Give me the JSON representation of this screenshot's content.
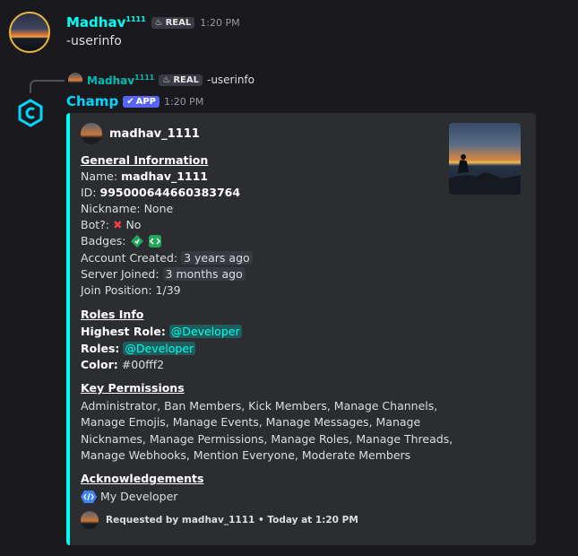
{
  "message1": {
    "author": "Madhav",
    "author_sup": "1111",
    "badge": "REAL",
    "time": "1:20 PM",
    "content": "-userinfo"
  },
  "reply_ref": {
    "author": "Madhav",
    "author_sup": "1111",
    "badge": "REAL",
    "content": "-userinfo"
  },
  "message2": {
    "author": "Champ",
    "badge": "APP",
    "time": "1:20 PM"
  },
  "embed": {
    "accent": "#00fff2",
    "author": "madhav_1111",
    "general_header": "General Information",
    "name_label": "Name:",
    "name_value": "madhav_1111",
    "id_label": "ID:",
    "id_value": "995000644660383764",
    "nickname_line": "Nickname: None",
    "bot_label": "Bot?:",
    "bot_value": "No",
    "badges_label": "Badges:",
    "account_label": "Account Created:",
    "account_value": "3 years ago",
    "server_label": "Server Joined:",
    "server_value": "3 months ago",
    "join_line": "Join Position: 1/39",
    "roles_header": "Roles Info",
    "highest_label": "Highest Role:",
    "highest_value": "@Developer",
    "roles_label": "Roles:",
    "roles_value": "@Developer",
    "color_label": "Color:",
    "color_value": "#00fff2",
    "perms_header": "Key Permissions",
    "perms_lines": [
      "Administrator, Ban Members, Kick Members, Manage Channels,",
      "Manage Emojis, Manage Events, Manage Messages, Manage",
      "Nicknames, Manage Permissions, Manage Roles, Manage Threads,",
      "Manage Webhooks, Mention Everyone, Moderate Members"
    ],
    "ack_header": "Acknowledgements",
    "ack_value": "My Developer",
    "footer": "Requested by madhav_1111 • Today at 1:20 PM"
  }
}
